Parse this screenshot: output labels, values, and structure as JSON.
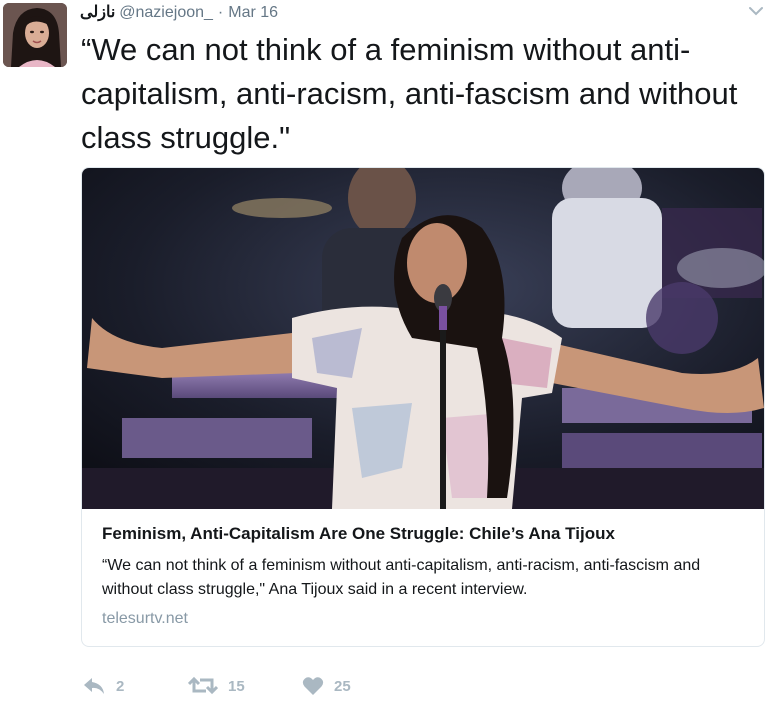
{
  "tweet": {
    "display_name": "نازلی",
    "handle": "@naziejoon_",
    "separator": "·",
    "date": "Mar 16",
    "text": "“We can not think of a feminism without anti-capitalism, anti-racism, anti-fascism and without class struggle.\""
  },
  "card": {
    "title": "Feminism, Anti-Capitalism Are One Struggle: Chile’s Ana Tijoux",
    "description": "“We can not think of a feminism without anti-capitalism, anti-racism, anti-fascism and without class struggle,\" Ana Tijoux said in a recent interview.",
    "domain": "telesurtv.net"
  },
  "actions": {
    "replies": "2",
    "retweets": "15",
    "likes": "25"
  },
  "icons": [
    "caret-down-icon",
    "reply-icon",
    "retweet-icon",
    "heart-icon"
  ],
  "colors": {
    "text": "#14171a",
    "muted": "#657786",
    "action_gray": "#aab8c2",
    "link_gray": "#8899a6"
  }
}
